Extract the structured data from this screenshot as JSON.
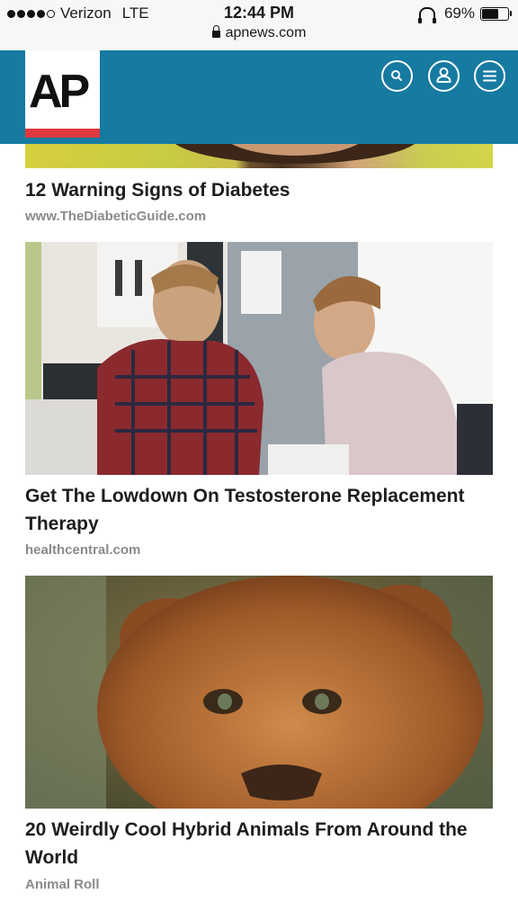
{
  "status_bar": {
    "carrier": "Verizon",
    "network": "LTE",
    "time": "12:44 PM",
    "url": "apnews.com",
    "battery_percent": "69%",
    "battery_level": 0.69
  },
  "header": {
    "logo_text": "AP",
    "icons": [
      "search-icon",
      "user-icon",
      "menu-icon"
    ],
    "colors": {
      "header_bg": "#167aa1",
      "logo_accent": "#e0393e"
    }
  },
  "feed": {
    "items": [
      {
        "headline": "12 Warning Signs of Diabetes",
        "source": "www.TheDiabeticGuide.com"
      },
      {
        "headline": "Get The Lowdown On Testosterone Replacement Therapy",
        "source": "healthcentral.com"
      },
      {
        "headline": "20 Weirdly Cool Hybrid Animals From Around the World",
        "source": "Animal Roll"
      }
    ]
  }
}
